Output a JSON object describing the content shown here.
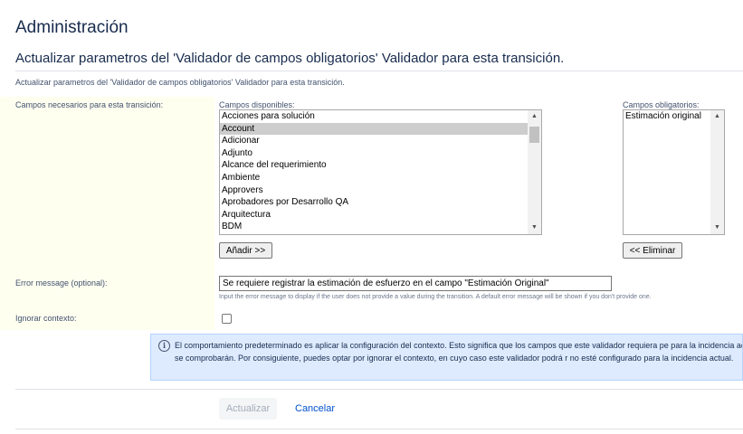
{
  "header": {
    "title": "Administración",
    "section_title": "Actualizar parametros del 'Validador de campos obligatorios' Validador para esta transición.",
    "description": "Actualizar parametros del 'Validador de campos obligatorios' Validador para esta transición."
  },
  "form": {
    "fields_label": "Campos necesarios para esta transición:",
    "available_caption": "Campos disponibles:",
    "available_options": [
      "Acciones para solución",
      "Account",
      "Adicionar",
      "Adjunto",
      "Alcance del requerimiento",
      "Ambiente",
      "Approvers",
      "Aprobadores por Desarrollo QA",
      "Arquitectura",
      "BDM"
    ],
    "available_selected": "Account",
    "add_button": "Añadir >>",
    "required_caption": "Campos obligatorios:",
    "required_options": [
      "Estimación original"
    ],
    "remove_button": "<< Eliminar",
    "error_label": "Error message (optional):",
    "error_value": "Se requiere registrar la estimación de esfuerzo en el campo \"Estimación Original\"",
    "error_help": "Input the error message to display if the user does not provide a value during the transition. A default error message will be shown if you don't provide one.",
    "ignore_label": "Ignorar contexto:",
    "ignore_checked": false,
    "info_icon": "info-icon",
    "info_text": "El comportamiento predeterminado es aplicar la configuración del contexto. Esto significa que los campos que este validador requiera pe para la incidencia actual no se comprobarán. Por consiguiente, puedes optar por ignorar el contexto, en cuyo caso este validador podrá r no esté configurado para la incidencia actual."
  },
  "actions": {
    "update_button": "Actualizar",
    "cancel_link": "Cancelar"
  },
  "colors": {
    "label_column_bg": "#fffff0",
    "info_bg": "#deebff",
    "link": "#0052cc"
  }
}
